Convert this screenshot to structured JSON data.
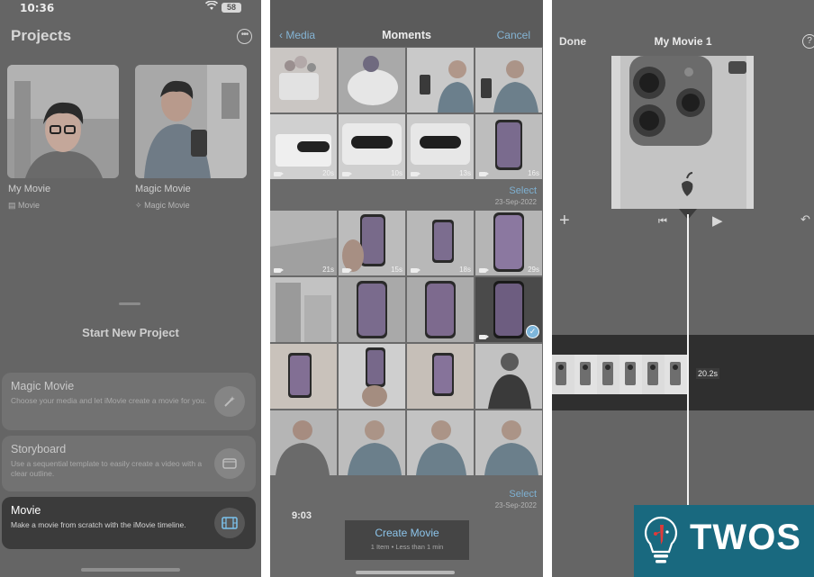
{
  "colors": {
    "ios_blue_dim": "#84b4d4",
    "movie_icon_blue": "#7cc4ef",
    "brand_teal": "#19697f",
    "brand_red": "#e03a3a"
  },
  "left_screen": {
    "status_time": "10:36",
    "battery": "58",
    "title": "Projects",
    "projects": [
      {
        "name": "My Movie",
        "type": "Movie",
        "type_icon": "film-icon"
      },
      {
        "name": "Magic Movie",
        "type": "Magic Movie",
        "type_icon": "magic-icon"
      }
    ],
    "start_new_title": "Start New Project",
    "options": {
      "magic": {
        "name": "Magic Movie",
        "desc": "Choose your media and let iMovie create a movie for you.",
        "icon": "magic-wand-icon"
      },
      "storyboard": {
        "name": "Storyboard",
        "desc": "Use a sequential template to easily create a video with a clear outline.",
        "icon": "storyboard-icon"
      },
      "movie": {
        "name": "Movie",
        "desc": "Make a movie from scratch with the iMovie timeline.",
        "icon": "film-strip-icon"
      }
    }
  },
  "middle_screen": {
    "back_label": "Media",
    "title": "Moments",
    "cancel_label": "Cancel",
    "group1_durations": [
      "",
      "",
      "",
      "",
      "20s",
      "10s",
      "13s",
      "16s"
    ],
    "section2": {
      "select": "Select",
      "date": "23-Sep-2022"
    },
    "group2_durations": [
      "21s",
      "15s",
      "18s",
      "29s",
      "",
      "",
      "",
      "",
      "",
      "",
      "",
      "",
      "",
      "",
      "",
      ""
    ],
    "section3": {
      "select": "Select",
      "date": "23-Sep-2022"
    },
    "partial_time": "9:03",
    "create_movie": "Create Movie",
    "create_sub": "1 Item • Less than 1 min"
  },
  "right_screen": {
    "done_label": "Done",
    "title": "My Movie 1",
    "help": "?",
    "clip_duration": "20.2s"
  },
  "watermark": {
    "word": "TWOS"
  }
}
